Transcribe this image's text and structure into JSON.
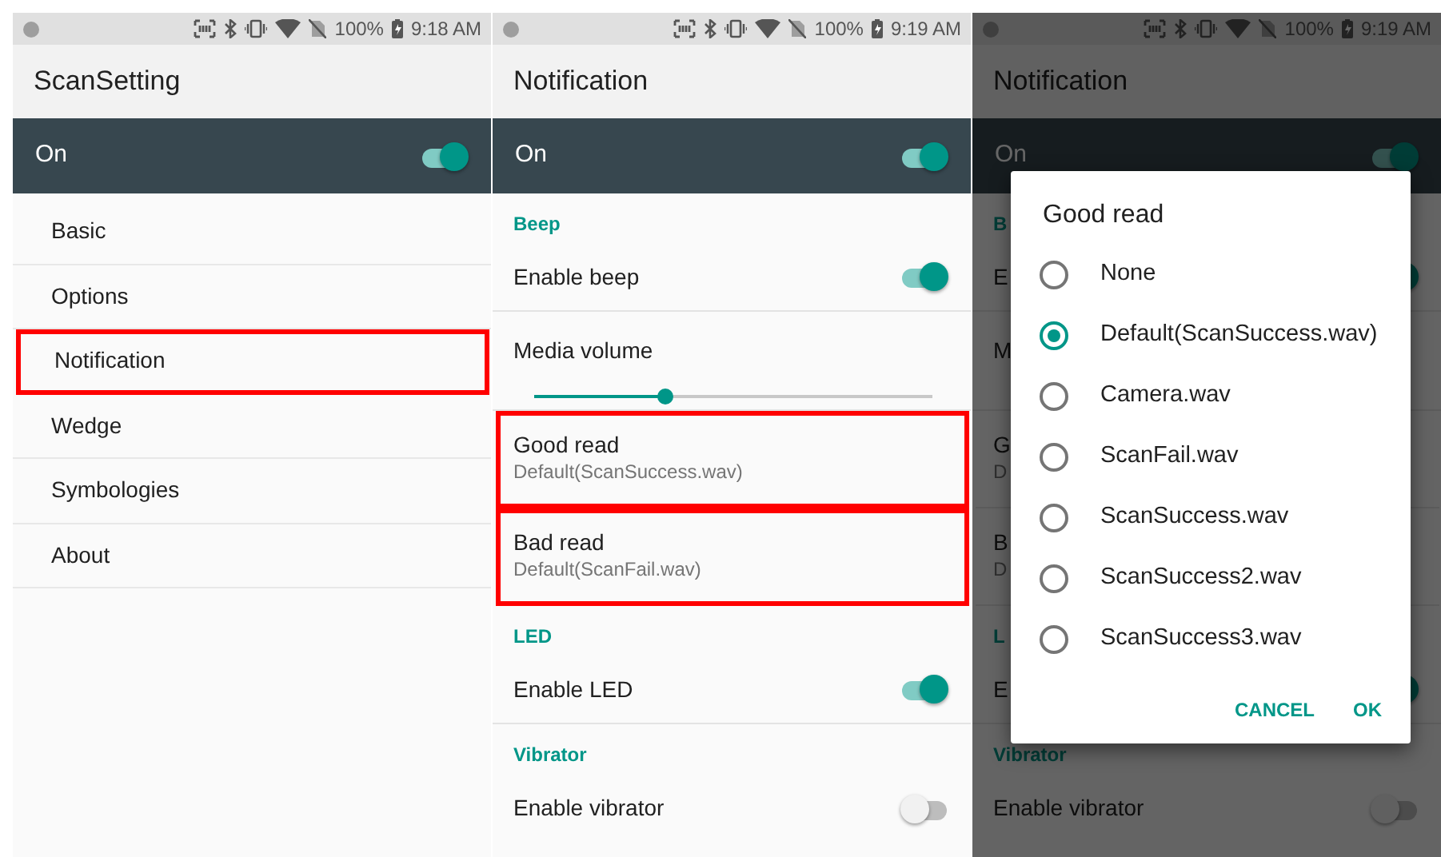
{
  "panels": [
    {
      "status_bar": {
        "battery": "100%",
        "time": "9:18 AM"
      },
      "title": "ScanSetting",
      "master_switch": {
        "label": "On",
        "on": true
      },
      "menu": [
        {
          "label": "Basic",
          "highlighted": false
        },
        {
          "label": "Options",
          "highlighted": false
        },
        {
          "label": "Notification",
          "highlighted": true
        },
        {
          "label": "Wedge",
          "highlighted": false
        },
        {
          "label": "Symbologies",
          "highlighted": false
        },
        {
          "label": "About",
          "highlighted": false
        }
      ]
    },
    {
      "status_bar": {
        "battery": "100%",
        "time": "9:19 AM"
      },
      "title": "Notification",
      "master_switch": {
        "label": "On",
        "on": true
      },
      "settings": [
        {
          "kind": "header",
          "label": "Beep"
        },
        {
          "kind": "switch",
          "label": "Enable beep",
          "on": true
        },
        {
          "kind": "slider",
          "label": "Media volume",
          "level": 0.33
        },
        {
          "kind": "pref",
          "label": "Good read",
          "summary": "Default(ScanSuccess.wav)",
          "highlighted": true
        },
        {
          "kind": "pref",
          "label": "Bad read",
          "summary": "Default(ScanFail.wav)",
          "highlighted": true
        },
        {
          "kind": "header",
          "label": "LED"
        },
        {
          "kind": "switch",
          "label": "Enable LED",
          "on": true
        },
        {
          "kind": "header",
          "label": "Vibrator"
        },
        {
          "kind": "switch",
          "label": "Enable vibrator",
          "on": false
        }
      ]
    },
    {
      "status_bar": {
        "battery": "100%",
        "time": "9:19 AM"
      },
      "title": "Notification",
      "master_switch": {
        "label": "On",
        "on": true
      },
      "settings": [
        {
          "kind": "header",
          "label": "B"
        },
        {
          "kind": "switch",
          "label": "E",
          "on": true
        },
        {
          "kind": "slider",
          "label": "M"
        },
        {
          "kind": "pref",
          "label": "G",
          "summary": "D"
        },
        {
          "kind": "pref",
          "label": "B",
          "summary": "D"
        },
        {
          "kind": "header",
          "label": "L"
        },
        {
          "kind": "switch",
          "label": "E",
          "on": true
        },
        {
          "kind": "header",
          "label": "Vibrator"
        },
        {
          "kind": "switch",
          "label": "Enable vibrator",
          "on": false
        }
      ],
      "dialog": {
        "title": "Good read",
        "options": [
          {
            "label": "None",
            "selected": false
          },
          {
            "label": "Default(ScanSuccess.wav)",
            "selected": true
          },
          {
            "label": "Camera.wav",
            "selected": false
          },
          {
            "label": "ScanFail.wav",
            "selected": false
          },
          {
            "label": "ScanSuccess.wav",
            "selected": false
          },
          {
            "label": "ScanSuccess2.wav",
            "selected": false
          },
          {
            "label": "ScanSuccess3.wav",
            "selected": false
          }
        ],
        "buttons": [
          "CANCEL",
          "OK"
        ]
      }
    }
  ]
}
